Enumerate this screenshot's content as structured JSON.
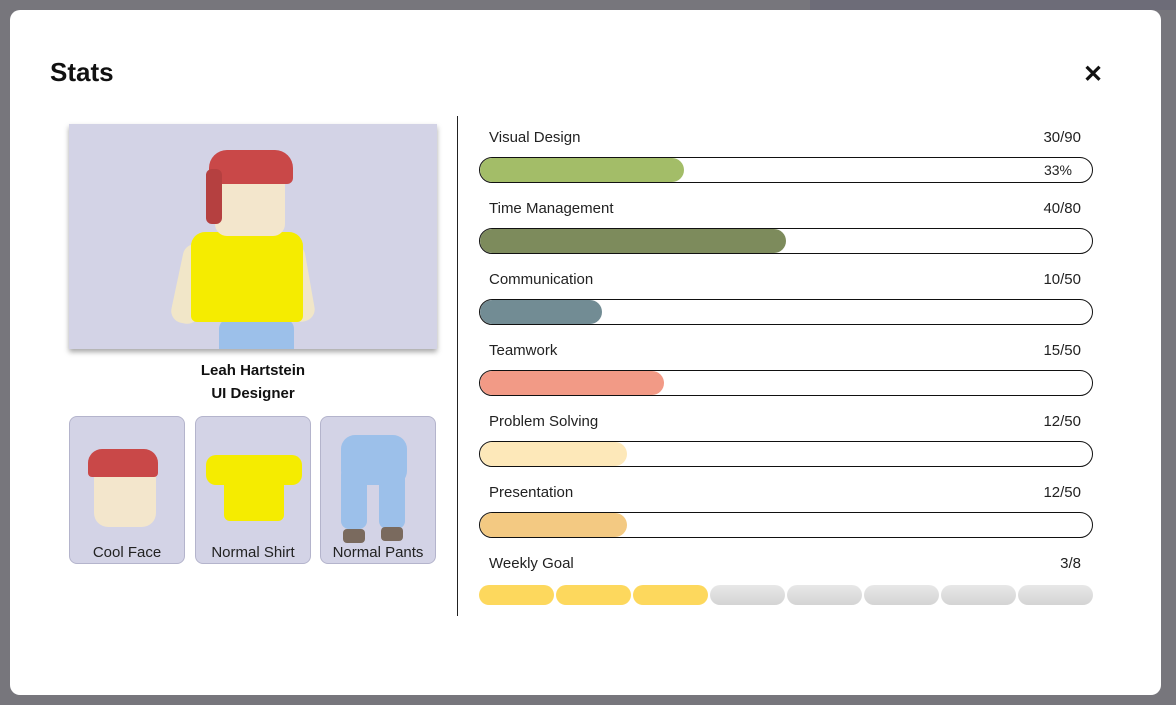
{
  "modal": {
    "title": "Stats",
    "close_icon": "close-icon"
  },
  "profile": {
    "name": "Leah Hartstein",
    "role": "UI Designer"
  },
  "items": [
    {
      "label": "Cool Face"
    },
    {
      "label": "Normal Shirt"
    },
    {
      "label": "Normal Pants"
    }
  ],
  "stats": [
    {
      "label": "Visual Design",
      "value": "30/90",
      "current": 30,
      "max": 90,
      "percent_label": "33%",
      "color": "#a3bd68"
    },
    {
      "label": "Time Management",
      "value": "40/80",
      "current": 40,
      "max": 80,
      "color": "#7d8b5c"
    },
    {
      "label": "Communication",
      "value": "10/50",
      "current": 10,
      "max": 50,
      "color": "#728c94"
    },
    {
      "label": "Teamwork",
      "value": "15/50",
      "current": 15,
      "max": 50,
      "color": "#f29a86"
    },
    {
      "label": "Problem Solving",
      "value": "12/50",
      "current": 12,
      "max": 50,
      "color": "#fde8b9"
    },
    {
      "label": "Presentation",
      "value": "12/50",
      "current": 12,
      "max": 50,
      "color": "#f3c982"
    }
  ],
  "weekly_goal": {
    "label": "Weekly Goal",
    "value": "3/8",
    "done": 3,
    "total": 8,
    "on_color": "#fdd85d"
  }
}
